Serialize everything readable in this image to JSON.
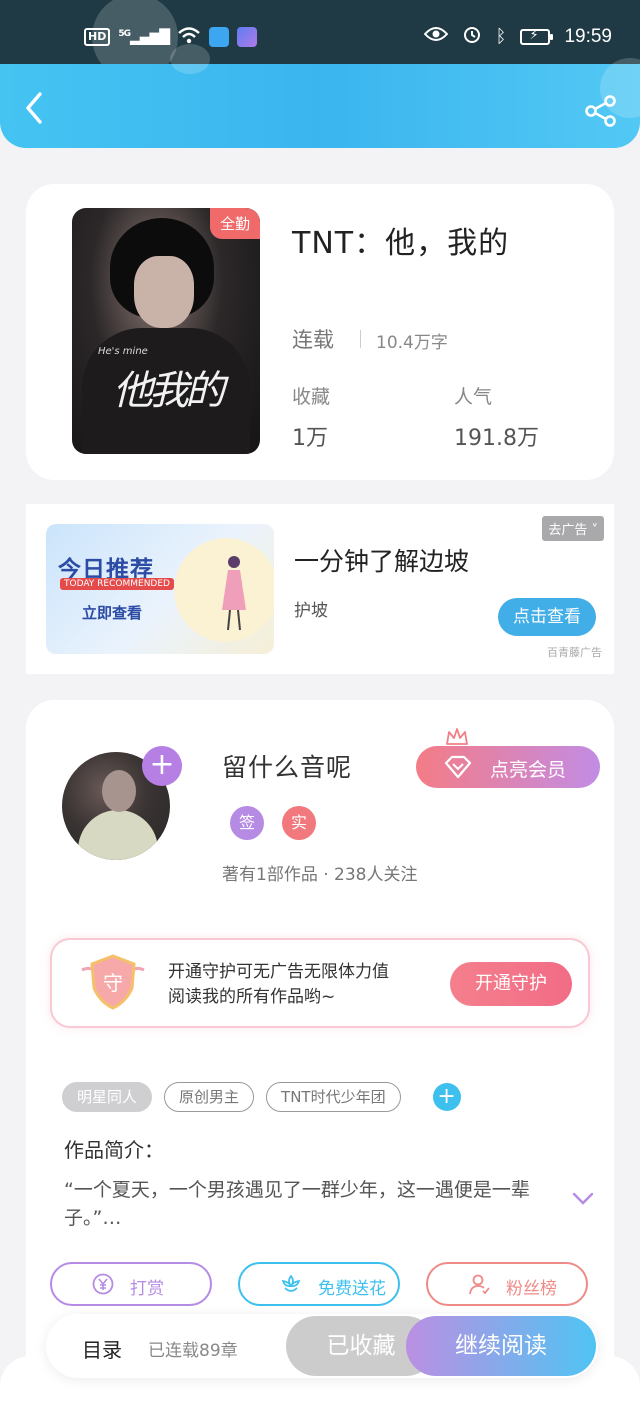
{
  "status": {
    "hd": "HD",
    "network": "5G",
    "time": "19:59"
  },
  "book": {
    "title": "TNT：他，我的",
    "badge": "全勤",
    "cover_title": "他我的",
    "cover_small": "He's mine",
    "status": "连载",
    "words": "10.4万字",
    "collect_label": "收藏",
    "collect_value": "1万",
    "pop_label": "人气",
    "pop_value": "191.8万"
  },
  "ad": {
    "img_big": "今日推荐",
    "img_en": "TODAY RECOMMENDED",
    "img_cta": "立即查看",
    "title": "一分钟了解边坡",
    "subtitle": "护坡",
    "remove_label": "去广告 ˅",
    "button": "点击查看",
    "source": "百青藤广告"
  },
  "author": {
    "name": "留什么音呢",
    "tag_sign": "签",
    "tag_real": "实",
    "stats": "著有1部作品 · 238人关注",
    "vip_button": "点亮会员",
    "follow_plus": "+"
  },
  "guard": {
    "shield_char": "守",
    "text_line1": "开通守护可无广告无限体力值",
    "text_line2": "阅读我的所有作品哟~",
    "button": "开通守护"
  },
  "tags": [
    "明星同人",
    "原创男主",
    "TNT时代少年团"
  ],
  "tag_add": "+",
  "intro": {
    "label": "作品简介：",
    "text": "“一个夏天，一个男孩遇见了一群少年，这一遇便是一辈子。”…"
  },
  "actions": {
    "reward": "打赏",
    "flower": "免费送花",
    "fans": "粉丝榜"
  },
  "bottom": {
    "catalog": "目录",
    "chapters": "已连载89章",
    "collected": "已收藏",
    "continue": "继续阅读"
  },
  "colors": {
    "header_blue": "#3bb5ef",
    "vip_gradient_start": "#f47c86",
    "vip_gradient_end": "#c28ce4",
    "guard_pink": "#f26c86",
    "reward_purple": "#b58be4",
    "flower_cyan": "#3ec0ef",
    "fans_red": "#ee8b88"
  }
}
